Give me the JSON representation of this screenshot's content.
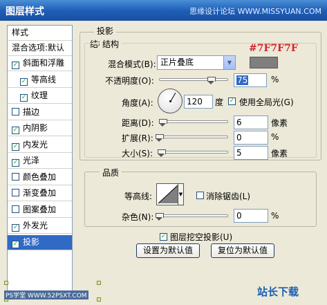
{
  "window": {
    "title": "图层样式",
    "watermark": "思缘设计论坛 WWW.MISSYUAN.COM"
  },
  "styles_list": {
    "header": "样式",
    "blend_options": "混合选项:默认",
    "items": [
      {
        "label": "斜面和浮雕",
        "checked": true,
        "sub": false,
        "selected": false
      },
      {
        "label": "等高线",
        "checked": true,
        "sub": true,
        "selected": false
      },
      {
        "label": "纹理",
        "checked": true,
        "sub": true,
        "selected": false
      },
      {
        "label": "描边",
        "checked": false,
        "sub": false,
        "selected": false
      },
      {
        "label": "内阴影",
        "checked": true,
        "sub": false,
        "selected": false
      },
      {
        "label": "内发光",
        "checked": true,
        "sub": false,
        "selected": false
      },
      {
        "label": "光泽",
        "checked": true,
        "sub": false,
        "selected": false
      },
      {
        "label": "颜色叠加",
        "checked": false,
        "sub": false,
        "selected": false
      },
      {
        "label": "渐变叠加",
        "checked": false,
        "sub": false,
        "selected": false
      },
      {
        "label": "图案叠加",
        "checked": false,
        "sub": false,
        "selected": false
      },
      {
        "label": "外发光",
        "checked": true,
        "sub": false,
        "selected": false
      },
      {
        "label": "投影",
        "checked": true,
        "sub": false,
        "selected": true
      }
    ]
  },
  "drop_shadow": {
    "title": "投影",
    "structure": {
      "title": "结构",
      "blend_mode_label": "混合模式(B):",
      "blend_mode_value": "正片叠底",
      "color_hex_annotation": "#7F7F7F",
      "shadow_color": "#7f7f7f",
      "opacity_label": "不透明度(O):",
      "opacity_value": "75",
      "opacity_unit": "%",
      "angle_label": "角度(A):",
      "angle_value": "120",
      "angle_unit": "度",
      "global_light_label": "使用全局光(G)",
      "global_light_checked": true,
      "distance_label": "距离(D):",
      "distance_value": "6",
      "distance_unit": "像素",
      "spread_label": "扩展(R):",
      "spread_value": "0",
      "spread_unit": "%",
      "size_label": "大小(S):",
      "size_value": "5",
      "size_unit": "像素"
    },
    "quality": {
      "title": "品质",
      "contour_label": "等高线:",
      "anti_alias_label": "消除锯齿(L)",
      "anti_alias_checked": false,
      "noise_label": "杂色(N):",
      "noise_value": "0",
      "noise_unit": "%"
    },
    "knockout_label": "图层挖空投影(U)",
    "knockout_checked": true,
    "make_default_button": "设置为默认值",
    "reset_default_button": "复位为默认值"
  },
  "watermarks": {
    "left": "PS学堂 WWW.52PSXT.COM",
    "right": "站长下载"
  }
}
